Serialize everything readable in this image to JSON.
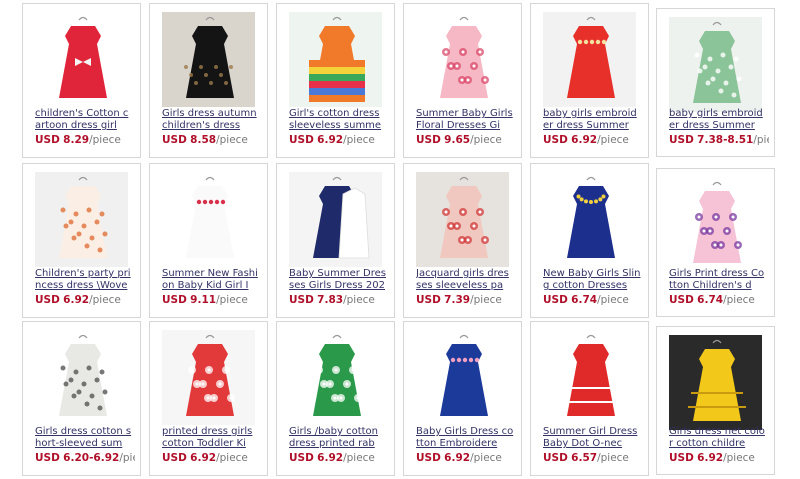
{
  "products": [
    {
      "title": "children's Cotton cartoon dress girl",
      "currency": "USD",
      "price": "8.29",
      "unit": "/piece",
      "dress_color": "#e0243a",
      "accent": "#f4f4f4",
      "bg": "#ffffff",
      "pattern": "bow"
    },
    {
      "title": "Girls dress autumn children's dress",
      "currency": "USD",
      "price": "8.58",
      "unit": "/piece",
      "dress_color": "#141414",
      "accent": "#9c7a4a",
      "bg": "#d9d4cc",
      "pattern": "tutu"
    },
    {
      "title": "Girl's cotton dress sleeveless summe",
      "currency": "USD",
      "price": "6.92",
      "unit": "/piece",
      "dress_color": "#f07a2a",
      "accent": "#3aa85a",
      "bg": "#eef4ef",
      "pattern": "stripes"
    },
    {
      "title": "Summer Baby Girls Floral Dresses Gi",
      "currency": "USD",
      "price": "9.65",
      "unit": "/piece",
      "dress_color": "#f5b8c4",
      "accent": "#d94a6a",
      "bg": "#ffffff",
      "pattern": "floral"
    },
    {
      "title": "baby girls embroider dress Summer",
      "currency": "USD",
      "price": "6.92",
      "unit": "/piece",
      "dress_color": "#e8302a",
      "accent": "#f5e0a0",
      "bg": "#f2f2f2",
      "pattern": "embroider"
    },
    {
      "title": "baby girls embroider dress Summer",
      "currency": "USD",
      "price": "7.38-8.51",
      "unit": "/pie",
      "dress_color": "#8cc49a",
      "accent": "#ffffff",
      "bg": "#eef2ee",
      "pattern": "dots"
    },
    {
      "title": "Children's party princess dress \\Wove",
      "currency": "USD",
      "price": "6.92",
      "unit": "/piece",
      "dress_color": "#fbeee4",
      "accent": "#e0703a",
      "bg": "#f0f0f0",
      "pattern": "dots"
    },
    {
      "title": "Summer New Fashion Baby Kid Girl I",
      "currency": "USD",
      "price": "9.11",
      "unit": "/piece",
      "dress_color": "#fafafa",
      "accent": "#d8304a",
      "bg": "#ffffff",
      "pattern": "embroider"
    },
    {
      "title": "Baby Summer Dresses Girls Dress 202",
      "currency": "USD",
      "price": "7.83",
      "unit": "/piece",
      "dress_color": "#1e2a6a",
      "accent": "#ffffff",
      "bg": "#f4f4f4",
      "pattern": "pair"
    },
    {
      "title": "Jacquard girls dresses sleeveless pa",
      "currency": "USD",
      "price": "7.39",
      "unit": "/piece",
      "dress_color": "#f0c8c0",
      "accent": "#d23a3a",
      "bg": "#e6e2de",
      "pattern": "floral"
    },
    {
      "title": "New Baby Girls Sling cotton Dresses",
      "currency": "USD",
      "price": "6.74",
      "unit": "/piece",
      "dress_color": "#1c2f8c",
      "accent": "#f0d040",
      "bg": "#ffffff",
      "pattern": "beads"
    },
    {
      "title": "Girls Print dress Cotton Children's d",
      "currency": "USD",
      "price": "6.74",
      "unit": "/piece",
      "dress_color": "#f6c2d6",
      "accent": "#7a3aa0",
      "bg": "#ffffff",
      "pattern": "floral"
    },
    {
      "title": "Girls dress cotton short-sleeved sum",
      "currency": "USD",
      "price": "6.20-6.92",
      "unit": "/piece",
      "dress_color": "#e8e8e4",
      "accent": "#555555",
      "bg": "#ffffff",
      "pattern": "dots"
    },
    {
      "title": "printed dress girls cotton Toddler Ki",
      "currency": "USD",
      "price": "6.92",
      "unit": "/piece",
      "dress_color": "#e23a3a",
      "accent": "#ffffff",
      "bg": "#f6f6f6",
      "pattern": "floral"
    },
    {
      "title": "Girls /baby cotton dress printed rab",
      "currency": "USD",
      "price": "6.92",
      "unit": "/piece",
      "dress_color": "#2a9a4a",
      "accent": "#ffffff",
      "bg": "#ffffff",
      "pattern": "floral"
    },
    {
      "title": "Baby Girls Dress cotton Embroidere",
      "currency": "USD",
      "price": "6.92",
      "unit": "/piece",
      "dress_color": "#1c3a9a",
      "accent": "#f0a0c0",
      "bg": "#ffffff",
      "pattern": "embroider"
    },
    {
      "title": "Summer Girl Dress Baby Dot O-nec",
      "currency": "USD",
      "price": "6.57",
      "unit": "/piece",
      "dress_color": "#e02a2a",
      "accent": "#ffffff",
      "bg": "#ffffff",
      "pattern": "tiers"
    },
    {
      "title": "Girls dress net color cotton childre",
      "currency": "USD",
      "price": "6.92",
      "unit": "/piece",
      "dress_color": "#f2c81a",
      "accent": "#c89a10",
      "bg": "#2a2a2a",
      "pattern": "tiers"
    }
  ]
}
